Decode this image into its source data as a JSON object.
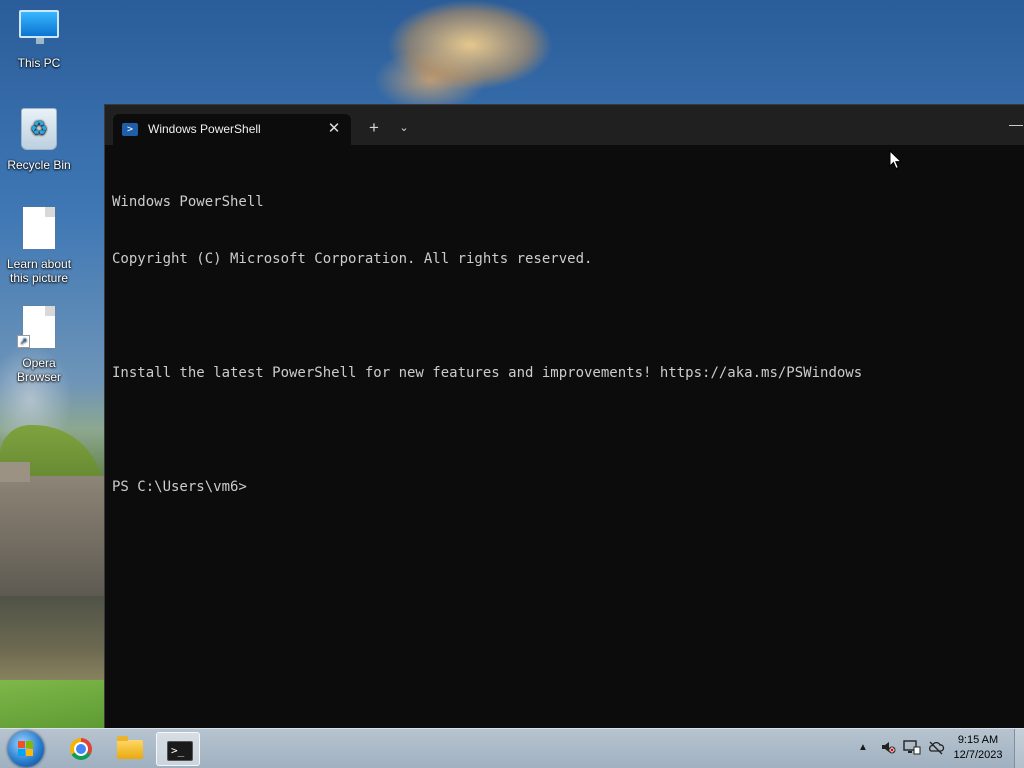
{
  "desktop": {
    "icons": [
      {
        "label": "This PC",
        "icon": "monitor-icon"
      },
      {
        "label": "Recycle Bin",
        "icon": "recycle-bin-icon"
      },
      {
        "label": "Learn about this picture",
        "icon": "document-icon"
      },
      {
        "label": "Opera Browser",
        "icon": "document-shortcut-icon"
      }
    ]
  },
  "terminal": {
    "tab": {
      "title": "Windows PowerShell",
      "icon": "powershell-icon",
      "close_glyph": "✕"
    },
    "new_tab_glyph": "+",
    "dropdown_glyph": "⌄",
    "minimize_glyph": "—",
    "console_lines": [
      "Windows PowerShell",
      "Copyright (C) Microsoft Corporation. All rights reserved.",
      "",
      "Install the latest PowerShell for new features and improvements! https://aka.ms/PSWindows",
      "",
      "PS C:\\Users\\vm6>"
    ],
    "background": "#0c0c0c",
    "text_color": "#cccccc"
  },
  "taskbar": {
    "pinned": [
      {
        "name": "chrome",
        "icon": "chrome-icon"
      },
      {
        "name": "file-explorer",
        "icon": "folder-icon"
      },
      {
        "name": "terminal",
        "icon": "terminal-icon",
        "active": true
      }
    ],
    "tray_icons": [
      "chevron-up-icon",
      "volume-muted-icon",
      "network-icon",
      "onedrive-offline-icon"
    ],
    "clock": {
      "time": "9:15 AM",
      "date": "12/7/2023"
    }
  }
}
